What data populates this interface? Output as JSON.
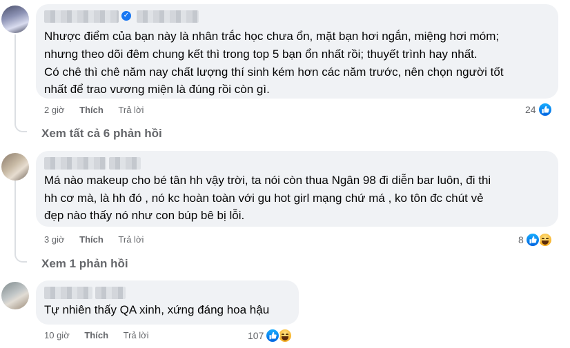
{
  "comments": [
    {
      "lines": [
        "Nhược điểm của bạn này là nhân trắc học chưa ổn, mặt bạn hơi ngắn, miệng hơi móm;",
        "nhưng theo dõi đêm chung kết thì trong top 5 bạn ổn nhất rồi; thuyết trình hay nhất.",
        "Có chê thì chê năm nay chất lượng thí sinh kém hơn các năm trước, nên chọn người tốt",
        "nhất để trao vương miện là đúng rồi còn gì."
      ],
      "time": "2 giờ",
      "like_label": "Thích",
      "reply_label": "Trả lời",
      "reaction_count": "24",
      "reactions": [
        "like-icon"
      ],
      "view_replies": "Xem tất cả 6 phản hồi"
    },
    {
      "lines": [
        "Má nào makeup cho bé tân hh vậy trời, ta nói còn thua Ngân 98 đi diễn bar luôn, đi thi",
        "hh cơ mà, là hh đó , nó kc hoàn toàn với gu hot girl mạng chứ má , ko tôn đc chút vẻ",
        "đẹp nào thấy nó như con búp bê bị lỗi."
      ],
      "time": "3 giờ",
      "like_label": "Thích",
      "reply_label": "Trả lời",
      "reaction_count": "8",
      "reactions": [
        "like-icon",
        "haha-icon"
      ],
      "view_replies": "Xem 1 phản hồi"
    },
    {
      "lines": [
        "Tự nhiên thấy QA xinh, xứng đáng hoa hậu"
      ],
      "time": "10 giờ",
      "like_label": "Thích",
      "reply_label": "Trả lời",
      "reaction_count": "107",
      "reactions": [
        "like-icon",
        "haha-icon"
      ]
    }
  ],
  "colors": {
    "bubble": "#f0f2f5",
    "meta_text": "#65676b",
    "like_blue": "#1877f2"
  }
}
